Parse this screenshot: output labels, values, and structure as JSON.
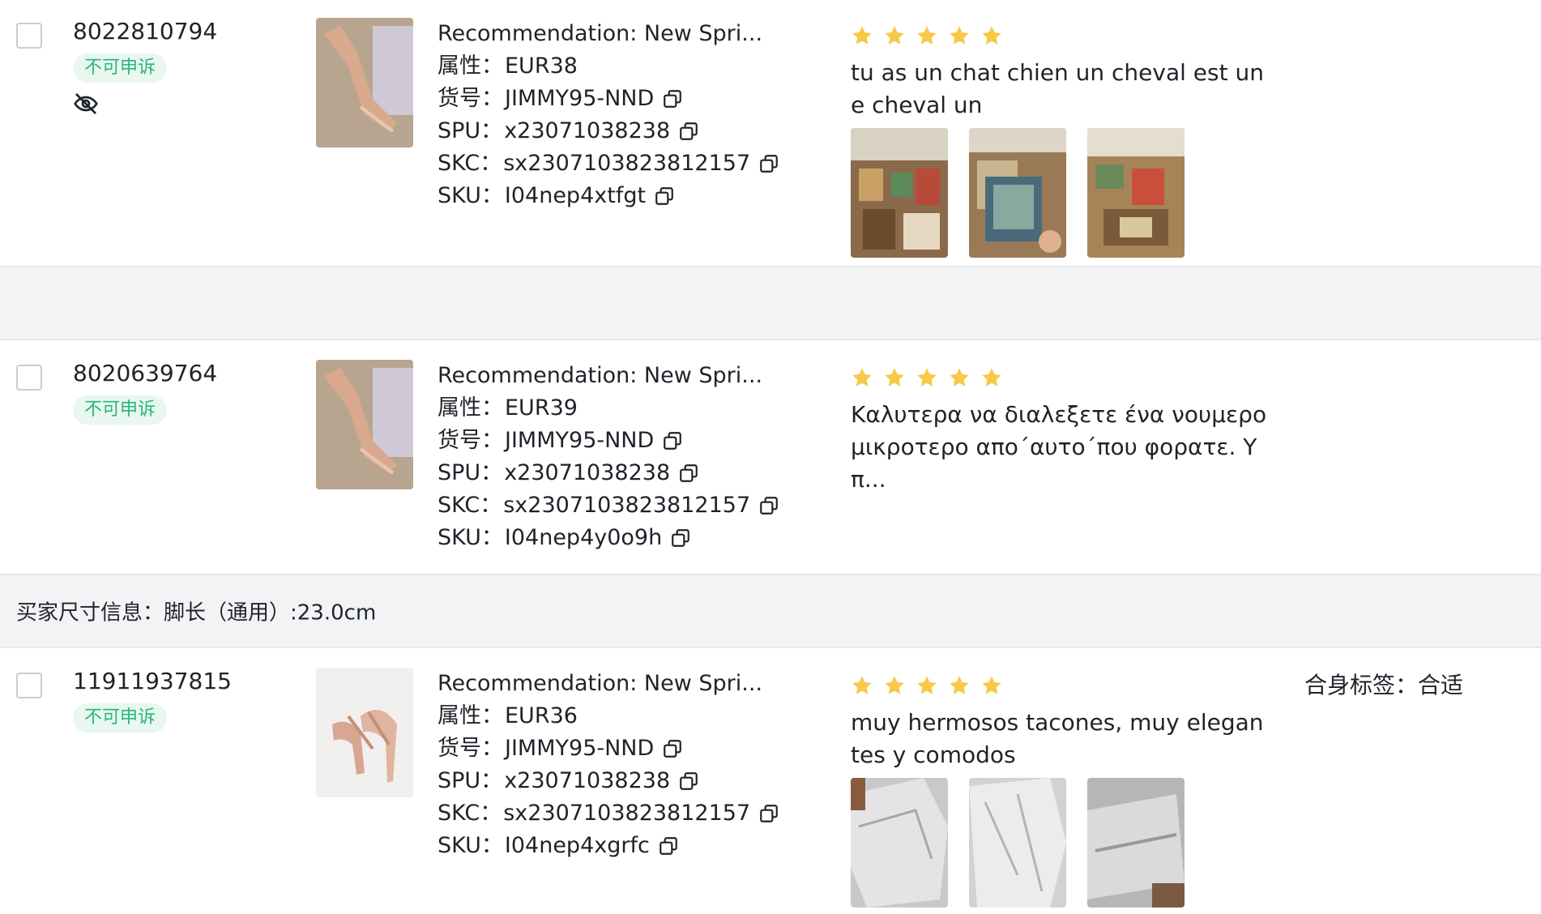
{
  "rows": [
    {
      "id": "8022810794",
      "badge": "不可申诉",
      "product": {
        "title": "Recommendation: New Spri...",
        "attr_label": "属性：",
        "attr_value": "EUR38",
        "sku_no_label": "货号：",
        "sku_no_value": "JIMMY95-NND",
        "spu_label": "SPU：",
        "spu_value": "x23071038238",
        "skc_label": "SKC：",
        "skc_value": "sx2307103823812157",
        "sku_label": "SKU：",
        "sku_value": "I04nep4xtfgt"
      },
      "rating": 5,
      "review_text": "tu as un chat chien un cheval est une cheval un",
      "photo_count": 3
    },
    {
      "id": "8020639764",
      "badge": "不可申诉",
      "product": {
        "title": "Recommendation: New Spri...",
        "attr_label": "属性：",
        "attr_value": "EUR39",
        "sku_no_label": "货号：",
        "sku_no_value": "JIMMY95-NND",
        "spu_label": "SPU：",
        "spu_value": "x23071038238",
        "skc_label": "SKC：",
        "skc_value": "sx2307103823812157",
        "sku_label": "SKU：",
        "sku_value": "I04nep4y0o9h"
      },
      "rating": 5,
      "review_text": "Καλυτερα να διαλεξετε ένα νουμερο μικροτερο απο΄αυτο΄που φορατε. Υπ..."
    },
    {
      "id": "11911937815",
      "badge": "不可申诉",
      "product": {
        "title": "Recommendation: New Spri...",
        "attr_label": "属性：",
        "attr_value": "EUR36",
        "sku_no_label": "货号：",
        "sku_no_value": "JIMMY95-NND",
        "spu_label": "SPU：",
        "spu_value": "x23071038238",
        "skc_label": "SKC：",
        "skc_value": "sx2307103823812157",
        "sku_label": "SKU：",
        "sku_value": "I04nep4xgrfc"
      },
      "rating": 5,
      "review_text": "muy hermosos tacones, muy elegantes y comodos",
      "fit_tag": "合身标签：合适",
      "photo_count": 3
    }
  ],
  "buyer_size_info": "买家尺寸信息：脚长（通用）:23.0cm",
  "colors": {
    "badge_bg": "#e8f7f0",
    "badge_text": "#2bb57a",
    "star": "#f7c948",
    "band_bg": "#f2f3f5"
  }
}
